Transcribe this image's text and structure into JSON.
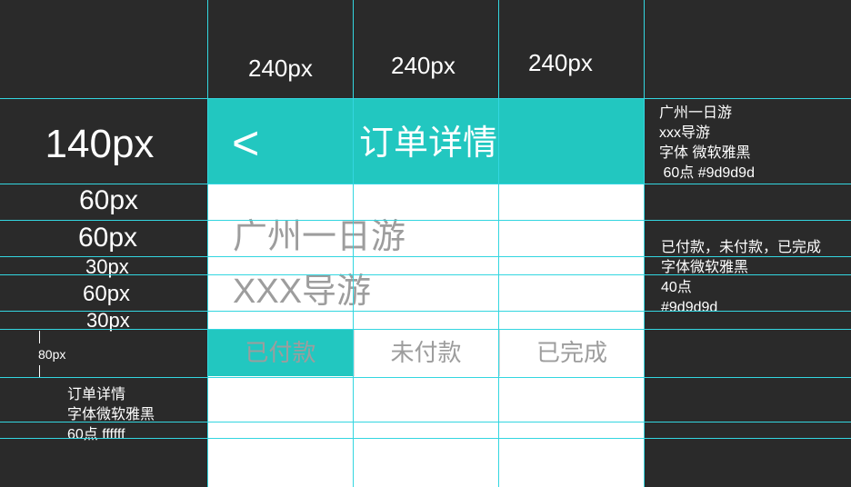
{
  "header": {
    "back_label": "<",
    "title": "订单详情"
  },
  "trip": {
    "name": "广州一日游",
    "guide": "XXX导游"
  },
  "tabs": [
    {
      "label": "已付款",
      "active": true
    },
    {
      "label": "未付款",
      "active": false
    },
    {
      "label": "已完成",
      "active": false
    }
  ],
  "column_widths": [
    "240px",
    "240px",
    "240px"
  ],
  "row_heights": {
    "header": "140px",
    "row1": "60px",
    "row2": "60px",
    "row3": "30px",
    "row4": "60px",
    "row5": "30px",
    "tabs": "80px"
  },
  "notes": {
    "title_font": [
      "订单详情",
      "字体微软雅黑",
      "60点 ffffff"
    ],
    "trip_font": [
      "广州一日游",
      "xxx导游",
      "字体 微软雅黑",
      " 60点 #9d9d9d"
    ],
    "tabs_font": [
      "已付款，未付款，已完成",
      "字体微软雅黑",
      "40点",
      "#9d9d9d"
    ]
  },
  "colors": {
    "accent": "#22c7c0",
    "guide_line": "#33d6e0",
    "text_gray": "#9d9d9d",
    "background": "#2a2a2a"
  }
}
